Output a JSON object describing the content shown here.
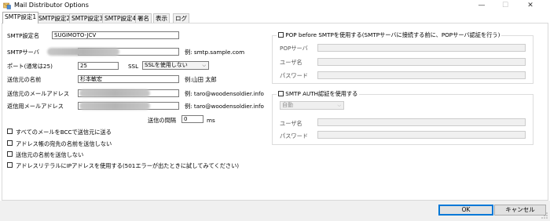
{
  "window": {
    "title": "Mail Distributor Options",
    "minimize_glyph": "—",
    "maximize_glyph": "☐",
    "close_glyph": "✕"
  },
  "tabs": [
    {
      "label": "SMTP設定1",
      "active": true
    },
    {
      "label": "SMTP設定2",
      "active": false
    },
    {
      "label": "SMTP設定3",
      "active": false
    },
    {
      "label": "SMTP設定4",
      "active": false
    },
    {
      "label": "署名",
      "active": false
    },
    {
      "label": "表示",
      "active": false
    },
    {
      "label": "ログ",
      "active": false
    }
  ],
  "smtp": {
    "name_label": "SMTP設定名",
    "name_value": "SUGIMOTO-JCV",
    "server_label": "SMTPサーバ",
    "server_example": "例: smtp.sample.com",
    "port_label": "ポート(通常は25)",
    "port_value": "25",
    "ssl_label": "SSL",
    "ssl_selected": "SSLを使用しない",
    "sender_name_label": "送信元の名前",
    "sender_name_value": "杉本敏宏",
    "sender_name_example": "例:山田 太郎",
    "sender_email_label": "送信元のメールアドレス",
    "sender_email_example": "例: taro@woodensoldier.info",
    "return_email_label": "返信用メールアドレス",
    "return_email_example": "例: taro@woodensoldier.info",
    "interval_label": "送信の間隔",
    "interval_value": "0",
    "interval_unit": "ms"
  },
  "checkboxes": [
    {
      "label": "すべてのメールをBCCで送信元に送る",
      "checked": false
    },
    {
      "label": "アドレス帳の宛先の名前を送信しない",
      "checked": false
    },
    {
      "label": "送信元の名前を送信しない",
      "checked": false
    },
    {
      "label": "アドレスリテラルにIPアドレスを使用する(501エラーが出たときに試してみてください)",
      "checked": false
    }
  ],
  "pop": {
    "enable_label": "POP before SMTPを使用する(SMTPサーバに接続する前に、POPサーバ認証を行う)",
    "server_label": "POPサーバ",
    "user_label": "ユーザ名",
    "password_label": "パスワード"
  },
  "auth": {
    "enable_label": "SMTP AUTH認証を使用する",
    "method_selected": "自動",
    "user_label": "ユーザ名",
    "password_label": "パスワード"
  },
  "buttons": {
    "ok": "OK",
    "cancel": "キャンセル"
  }
}
